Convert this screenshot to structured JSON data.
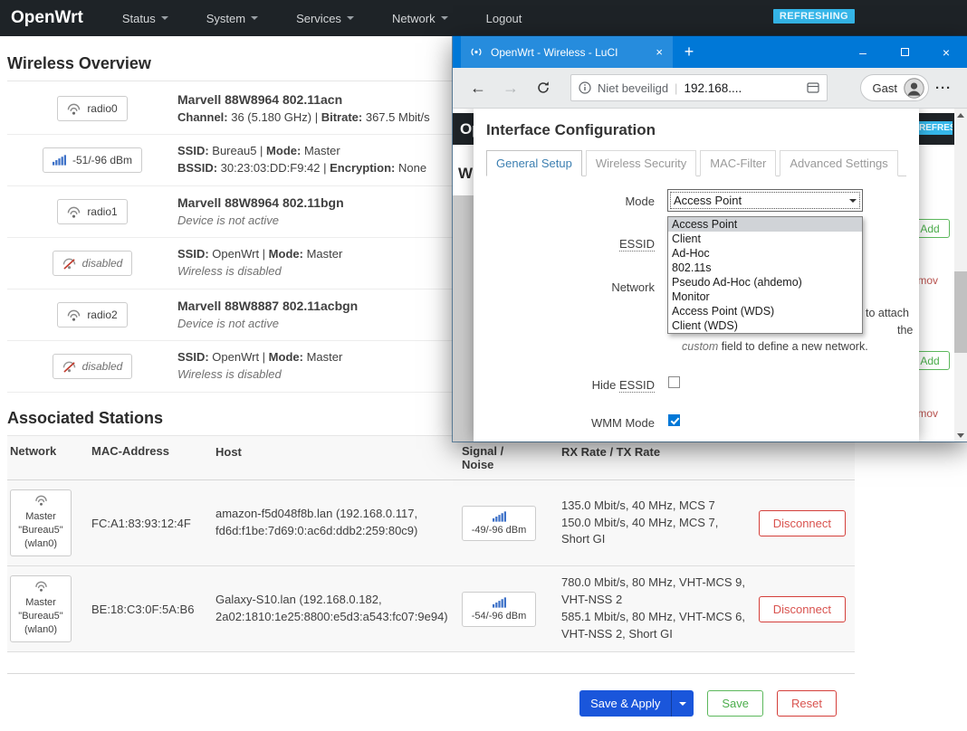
{
  "colors": {
    "navbar": "#1e2327",
    "titlebar_blue": "#0078d7",
    "refreshing_badge": "#35b6e9",
    "primary_button": "#1a56db",
    "success": "#5cb85c",
    "danger": "#d9534f",
    "active_tab_text": "#3c7fb1"
  },
  "navbar": {
    "brand": "OpenWrt",
    "items": [
      "Status",
      "System",
      "Services",
      "Network",
      "Logout"
    ],
    "refreshing": "REFRESHING"
  },
  "wireless": {
    "title": "Wireless Overview",
    "rows": [
      {
        "badge": "radio0",
        "lines": [
          [
            {
              "t": "Marvell 88W8964 802.11acn",
              "b": true
            }
          ],
          [
            {
              "t": "Channel:",
              "b": true
            },
            {
              "t": " 36 (5.180 GHz) | "
            },
            {
              "t": "Bitrate:",
              "b": true
            },
            {
              "t": " 367.5 Mbit/s"
            }
          ]
        ]
      },
      {
        "badge": "-51/-96 dBm",
        "lines": [
          [
            {
              "t": "SSID:",
              "b": true
            },
            {
              "t": " Bureau5 | "
            },
            {
              "t": "Mode:",
              "b": true
            },
            {
              "t": " Master"
            }
          ],
          [
            {
              "t": "BSSID:",
              "b": true
            },
            {
              "t": " 30:23:03:DD:F9:42 | "
            },
            {
              "t": "Encryption:",
              "b": true
            },
            {
              "t": " None"
            }
          ]
        ]
      },
      {
        "badge": "radio1",
        "lines": [
          [
            {
              "t": "Marvell 88W8964 802.11bgn",
              "b": true
            }
          ],
          [
            {
              "t": "Device is not active",
              "i": true
            }
          ]
        ]
      },
      {
        "badge": "disabled",
        "lines": [
          [
            {
              "t": "SSID:",
              "b": true
            },
            {
              "t": " OpenWrt | "
            },
            {
              "t": "Mode:",
              "b": true
            },
            {
              "t": " Master"
            }
          ],
          [
            {
              "t": "Wireless is disabled",
              "i": true
            }
          ]
        ]
      },
      {
        "badge": "radio2",
        "lines": [
          [
            {
              "t": "Marvell 88W8887 802.11acbgn",
              "b": true
            }
          ],
          [
            {
              "t": "Device is not active",
              "i": true
            }
          ]
        ]
      },
      {
        "badge": "disabled",
        "lines": [
          [
            {
              "t": "SSID:",
              "b": true
            },
            {
              "t": " OpenWrt | "
            },
            {
              "t": "Mode:",
              "b": true
            },
            {
              "t": " Master"
            }
          ],
          [
            {
              "t": "Wireless is disabled",
              "i": true
            }
          ]
        ]
      }
    ]
  },
  "stations": {
    "title": "Associated Stations",
    "headers": [
      "Network",
      "MAC-Address",
      "Host",
      "Signal / Noise",
      "RX Rate / TX Rate"
    ],
    "rows": [
      {
        "net_mode": "Master",
        "net_ssid": "\"Bureau5\"",
        "net_dev": "(wlan0)",
        "mac": "FC:A1:83:93:12:4F",
        "host": "amazon-f5d048f8b.lan (192.168.0.117, fd6d:f1be:7d69:0:ac6d:ddb2:259:80c9)",
        "signal": "-49/-96 dBm",
        "rx": "135.0 Mbit/s, 40 MHz, MCS 7",
        "tx": "150.0 Mbit/s, 40 MHz, MCS 7, Short GI",
        "action": "Disconnect"
      },
      {
        "net_mode": "Master",
        "net_ssid": "\"Bureau5\"",
        "net_dev": "(wlan0)",
        "mac": "BE:18:C3:0F:5A:B6",
        "host": "Galaxy-S10.lan (192.168.0.182, 2a02:1810:1e25:8800:e5d3:a543:fc07:9e94)",
        "signal": "-54/-96 dBm",
        "rx": "780.0 Mbit/s, 80 MHz, VHT-MCS 9, VHT-NSS 2",
        "tx": "585.1 Mbit/s, 80 MHz, VHT-MCS 6, VHT-NSS 2, Short GI",
        "action": "Disconnect"
      }
    ]
  },
  "footer": {
    "save_apply": "Save & Apply",
    "save": "Save",
    "reset": "Reset"
  },
  "browser": {
    "tab_title": "OpenWrt - Wireless - LuCI",
    "security_text": "Niet beveiligd",
    "url_text": "192.168....",
    "profile_label": "Gast"
  },
  "inner": {
    "brand_fragment": "Op",
    "heading_fragment": "Wi",
    "refreshing": "REFRESHING",
    "add_label": "Add",
    "remove_label": "Remove"
  },
  "modal": {
    "title": "Interface Configuration",
    "tabs": [
      "General Setup",
      "Wireless Security",
      "MAC-Filter",
      "Advanced Settings"
    ],
    "mode_label": "Mode",
    "mode_value": "Access Point",
    "essid_label": "ESSID",
    "network_label": "Network",
    "hide_label_prefix": "Hide ",
    "hide_essid": "ESSID",
    "wmm_label": "WMM Mode",
    "hide_checked": false,
    "wmm_checked": true,
    "options": [
      "Access Point",
      "Client",
      "Ad-Hoc",
      "802.11s",
      "Pseudo Ad-Hoc (ahdemo)",
      "Monitor",
      "Access Point (WDS)",
      "Client (WDS)"
    ],
    "help": {
      "frag1": "to attach",
      "frag2": "the",
      "frag3_italic": "custom",
      "frag3_rest": " field to define a new network."
    }
  }
}
